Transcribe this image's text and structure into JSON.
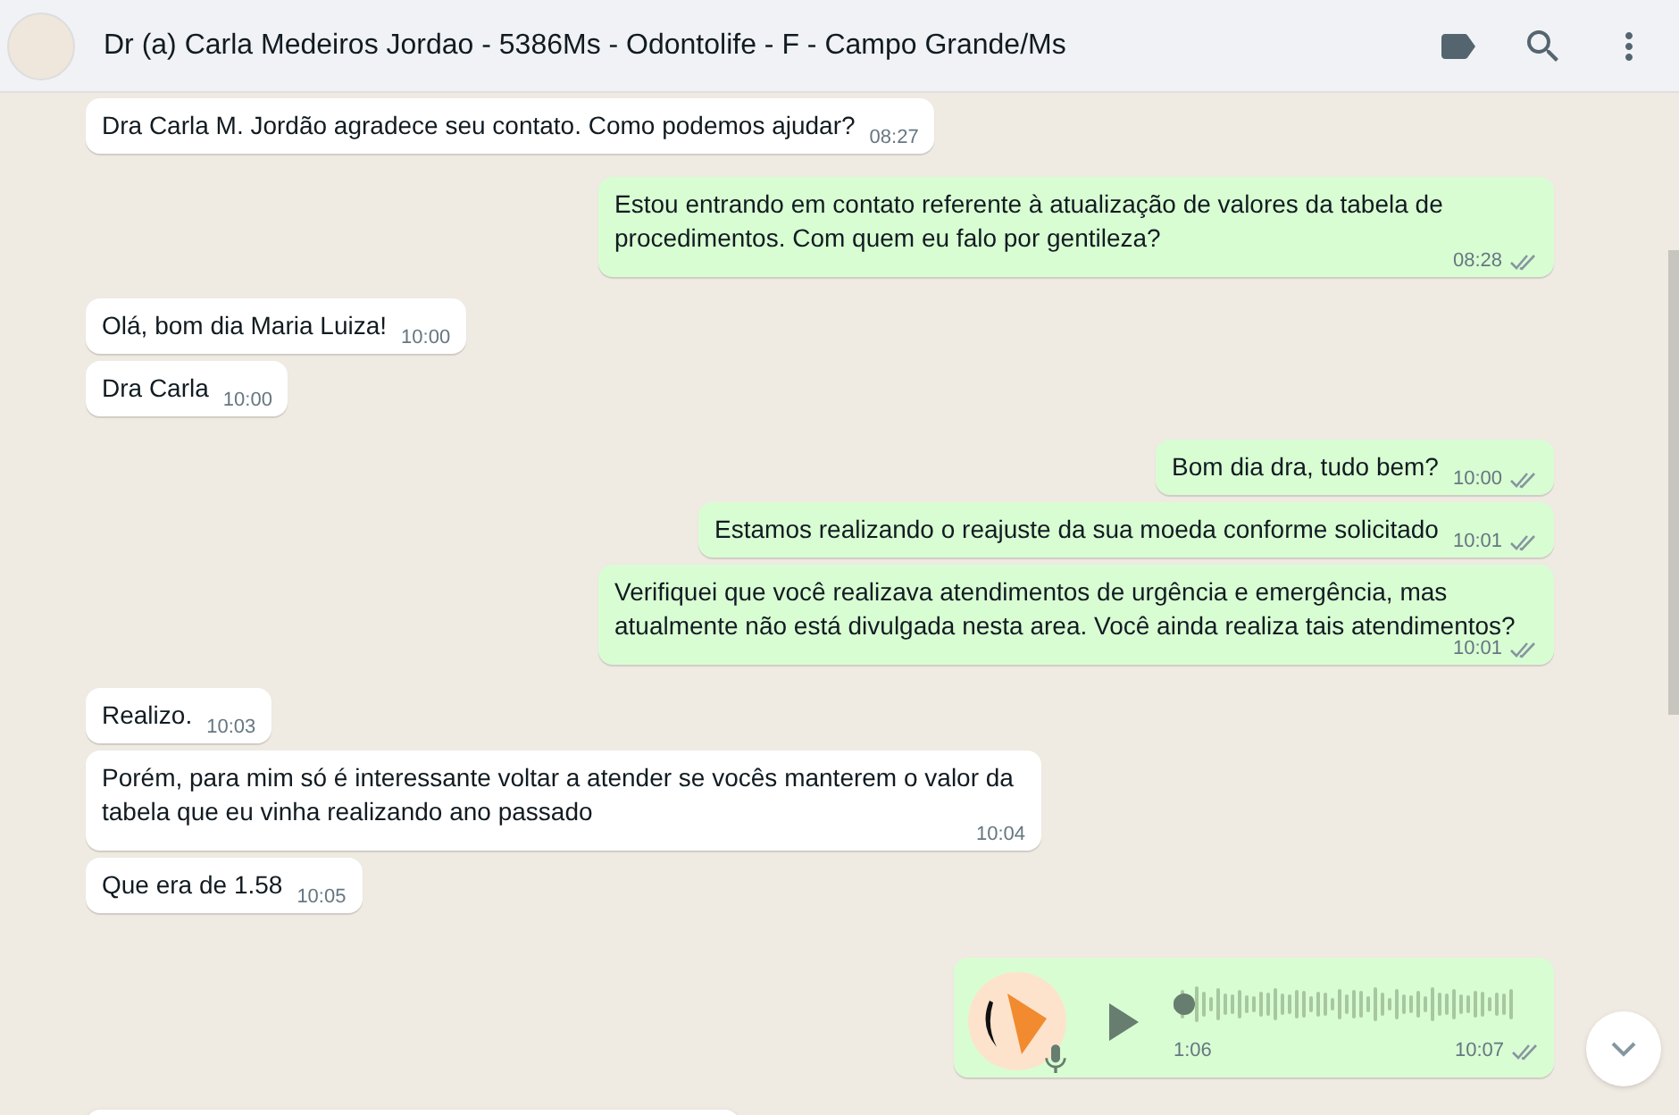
{
  "header": {
    "title": "Dr (a) Carla Medeiros Jordao - 5386Ms - Odontolife - F - Campo Grande/Ms"
  },
  "messages": [
    {
      "kind": "text",
      "outgoing": false,
      "text": "Dra Carla M. Jordão agradece seu contato. Como podemos ajudar?",
      "time": "08:27"
    },
    {
      "kind": "text",
      "outgoing": true,
      "text": "Estou entrando em contato referente à atualização de valores da tabela de procedimentos. Com quem eu falo por gentileza?",
      "time": "08:28",
      "read": false
    },
    {
      "kind": "text",
      "outgoing": false,
      "text": "Olá, bom dia Maria Luiza!",
      "time": "10:00"
    },
    {
      "kind": "text",
      "outgoing": false,
      "text": "Dra Carla",
      "time": "10:00"
    },
    {
      "kind": "text",
      "outgoing": true,
      "text": "Bom dia dra, tudo bem?",
      "time": "10:00",
      "read": false
    },
    {
      "kind": "text",
      "outgoing": true,
      "text": "Estamos realizando o reajuste da sua moeda conforme solicitado",
      "time": "10:01",
      "read": false
    },
    {
      "kind": "text",
      "outgoing": true,
      "text": "Verifiquei que você realizava atendimentos de urgência e emergência, mas atualmente não está divulgada nesta area. Você ainda realiza tais atendimentos?",
      "time": "10:01",
      "read": false
    },
    {
      "kind": "text",
      "outgoing": false,
      "text": "Realizo.",
      "time": "10:03"
    },
    {
      "kind": "text",
      "outgoing": false,
      "text": "Porém, para mim só é interessante voltar a atender se vocês manterem o valor da tabela que eu vinha realizando ano passado",
      "time": "10:04"
    },
    {
      "kind": "text",
      "outgoing": false,
      "text": "Que era de 1.58",
      "time": "10:05"
    },
    {
      "kind": "audio",
      "outgoing": true,
      "duration": "1:06",
      "time": "10:07",
      "read": false
    },
    {
      "kind": "cut",
      "outgoing": false
    }
  ]
}
